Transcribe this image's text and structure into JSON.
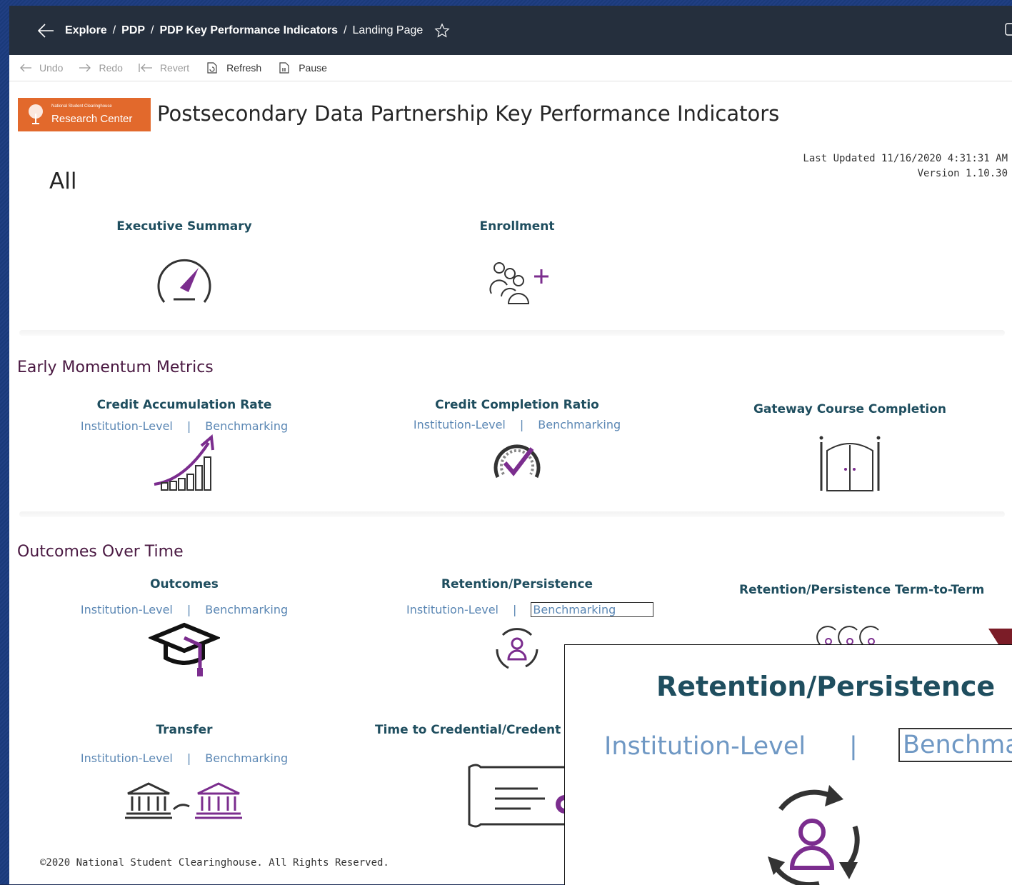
{
  "breadcrumb": [
    "Explore",
    "PDP",
    "PDP Key Performance Indicators",
    "Landing Page"
  ],
  "toolbar": {
    "undo": "Undo",
    "redo": "Redo",
    "revert": "Revert",
    "refresh": "Refresh",
    "pause": "Pause"
  },
  "logo": {
    "small": "National Student Clearinghouse",
    "big": "Research Center"
  },
  "page_title": "Postsecondary Data Partnership Key Performance Indicators",
  "meta": {
    "updated": "Last Updated 11/16/2020 4:31:31 AM",
    "version": "Version 1.10.30"
  },
  "all": {
    "heading": "All",
    "cards": [
      {
        "title": "Executive Summary",
        "icon": "speedometer-icon"
      },
      {
        "title": "Enrollment",
        "icon": "people-add-icon"
      }
    ]
  },
  "early": {
    "heading": "Early Momentum Metrics",
    "cards": [
      {
        "title": "Credit Accumulation Rate",
        "link1": "Institution-Level",
        "sep": "|",
        "link2": "Benchmarking",
        "icon": "growth-chart-icon"
      },
      {
        "title": "Credit Completion Ratio",
        "link1": "Institution-Level",
        "sep": "|",
        "link2": "Benchmarking",
        "icon": "checkmark-gauge-icon"
      },
      {
        "title": "Gateway Course Completion",
        "icon": "gateway-door-icon"
      }
    ]
  },
  "outcomes": {
    "heading": "Outcomes Over Time",
    "cards": [
      {
        "title": "Outcomes",
        "link1": "Institution-Level",
        "sep": "|",
        "link2": "Benchmarking",
        "icon": "graduation-cap-icon"
      },
      {
        "title": "Retention/Persistence",
        "link1": "Institution-Level",
        "sep": "|",
        "link2": "Benchmarking",
        "icon": "retention-cycle-icon"
      },
      {
        "title": "Retention/Persistence Term-to-Term",
        "icon": "term-cycle-icon"
      },
      {
        "title": "Transfer",
        "link1": "Institution-Level",
        "sep": "|",
        "link2": "Benchmarking",
        "icon": "institution-transfer-icon"
      },
      {
        "title": "Time to Credential/Credent",
        "icon": "certificate-icon"
      }
    ]
  },
  "footer": "©2020 National Student Clearinghouse. All Rights Reserved.",
  "zoom": {
    "title": "Retention/Persistence",
    "link1": "Institution-Level",
    "sep": "|",
    "link2": "Benchmarking"
  },
  "colors": {
    "nav": "#252f3d",
    "accent": "#7b2d8e",
    "title": "#1f4e5f",
    "link": "#5b87b4",
    "section": "#4a1942",
    "logo": "#e2692c"
  }
}
